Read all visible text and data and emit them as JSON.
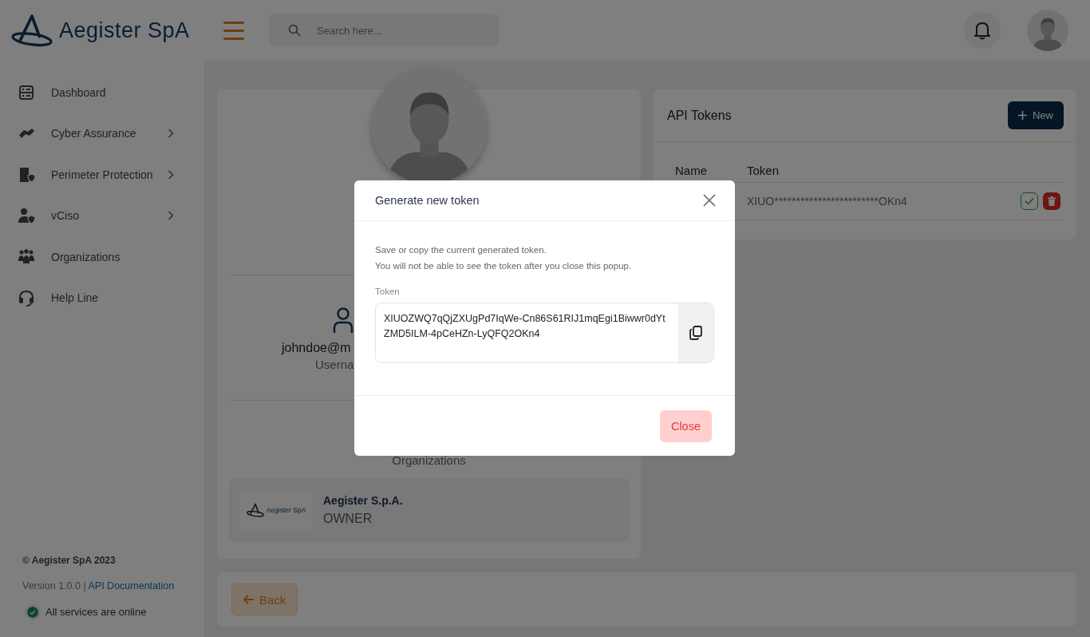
{
  "header": {
    "brand": "Aegister SpA",
    "search": {
      "placeholder": "Search here..."
    }
  },
  "sidebar": {
    "items": [
      {
        "label": "Dashboard",
        "expandable": false
      },
      {
        "label": "Cyber Assurance",
        "expandable": true
      },
      {
        "label": "Perimeter Protection",
        "expandable": true
      },
      {
        "label": "vCiso",
        "expandable": true
      },
      {
        "label": "Organizations",
        "expandable": false
      },
      {
        "label": "Help Line",
        "expandable": false
      }
    ],
    "footer": {
      "copyright": "© Aegister SpA 2023",
      "version": "Version 1.0.0 |",
      "link": "API Documentation",
      "status": {
        "text": "All services are online",
        "online": true
      }
    }
  },
  "profile": {
    "email": "johndoe@m",
    "email_caption": "Userna",
    "organizations_title": "Organizations",
    "organizations": [
      {
        "logo_text": "Aegister SpA",
        "name": "Aegister S.p.A.",
        "role": "OWNER"
      }
    ]
  },
  "api_tokens": {
    "title": "API Tokens",
    "new_button": "New",
    "columns": [
      "Name",
      "Token"
    ],
    "rows": [
      {
        "token": "XIUO************************OKn4"
      }
    ]
  },
  "back_button": "Back",
  "modal": {
    "title": "Generate new token",
    "lines": [
      "Save or copy the current generated token.",
      "You will not be able to see the token after you close this popup."
    ],
    "token_label": "Token",
    "token_value": "XIUOZWQ7qQjZXUgPd7IqWe-Cn86S61RIJ1mqEgi1Biwwr0dYtZMD5ILM-4pCeHZn-LyQFQ2OKn4",
    "close_button": "Close"
  }
}
